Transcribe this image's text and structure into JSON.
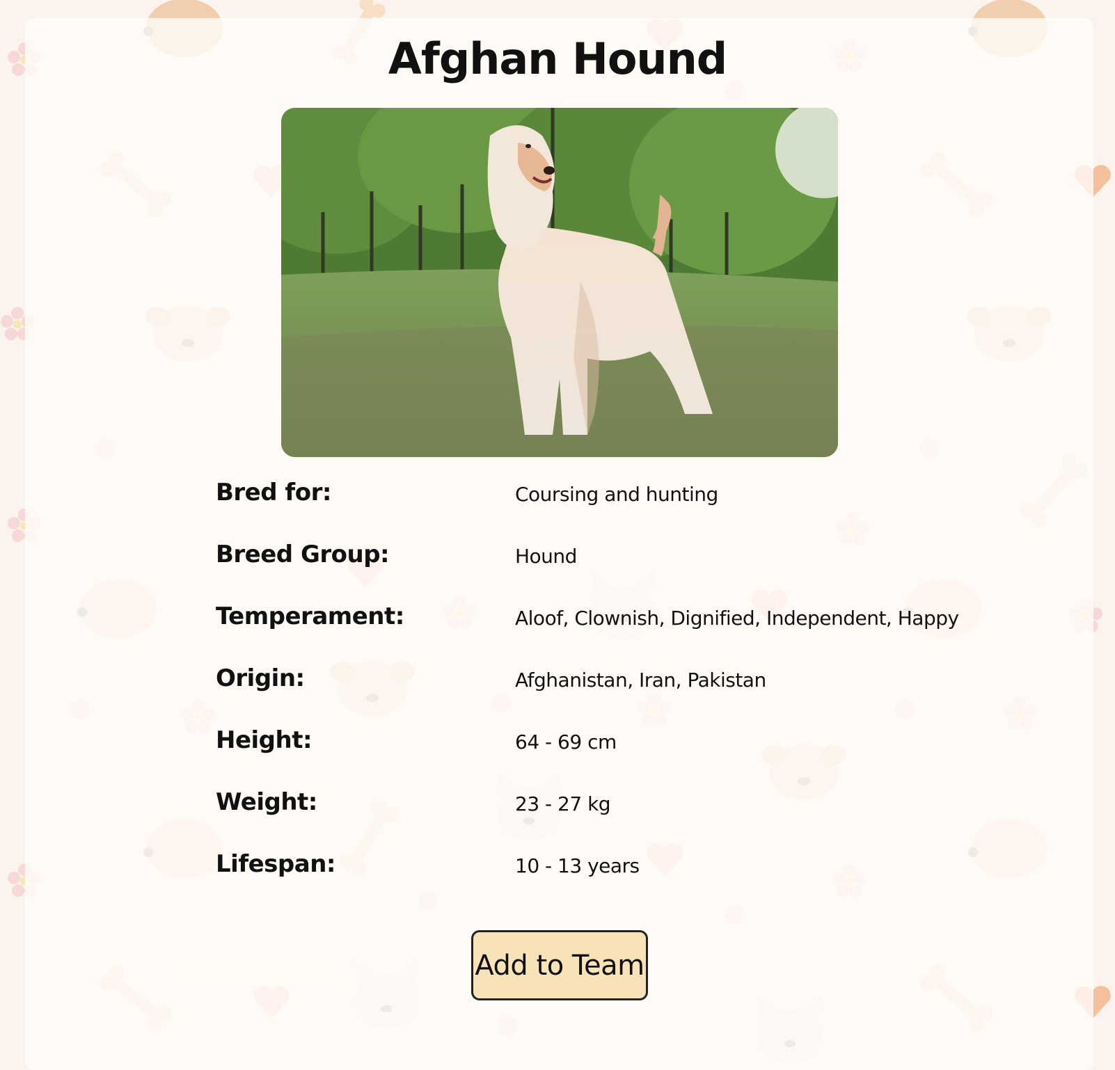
{
  "breed": {
    "name": "Afghan Hound",
    "image_alt": "Afghan Hound"
  },
  "details": [
    {
      "label": "Bred for:",
      "value": "Coursing and hunting"
    },
    {
      "label": "Breed Group:",
      "value": "Hound"
    },
    {
      "label": "Temperament:",
      "value": "Aloof, Clownish, Dignified, Independent, Happy"
    },
    {
      "label": "Origin:",
      "value": "Afghanistan, Iran, Pakistan"
    },
    {
      "label": "Height:",
      "value": "64 - 69 cm"
    },
    {
      "label": "Weight:",
      "value": "23 - 27 kg"
    },
    {
      "label": "Lifespan:",
      "value": "10 - 13 years"
    }
  ],
  "actions": {
    "add_label": "Add to Team"
  },
  "colors": {
    "button_bg": "#f8e3b9",
    "page_bg": "#fbf3ee"
  },
  "icons": [
    "bone-icon",
    "heart-icon",
    "dog-face-icon",
    "flower-icon",
    "paw-dot-icon"
  ]
}
